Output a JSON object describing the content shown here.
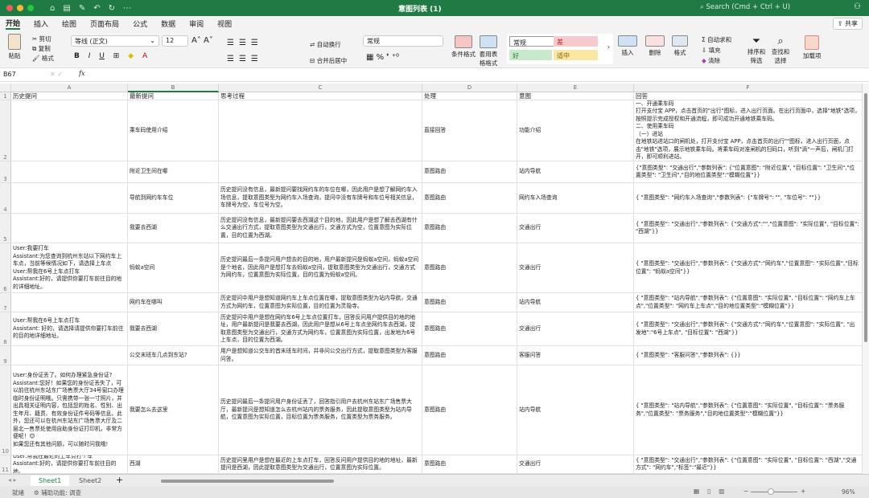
{
  "window": {
    "title": "意图列表 (1)",
    "search_placeholder": "Search (Cmd + Ctrl + U)"
  },
  "colors": {
    "titlebar": "#1f7a44",
    "bad": "#f7c9cc",
    "good": "#c9e9cc",
    "neutral": "#fbe7a4"
  },
  "menu": [
    "开始",
    "插入",
    "绘图",
    "页面布局",
    "公式",
    "数据",
    "审阅",
    "视图"
  ],
  "share_label": "共享",
  "ribbon": {
    "paste": "粘贴",
    "cut": "剪切",
    "copy": "复制",
    "format_painter": "格式",
    "font": "等线 (正文)",
    "size": "12",
    "wrap": "自动换行",
    "merge": "合并后居中",
    "number_format": "常规",
    "cond_format": "条件格式",
    "table_format": "套用表格格式",
    "styles": {
      "normal": "常规",
      "bad": "差",
      "good": "好",
      "neutral": "适中"
    },
    "insert": "插入",
    "delete": "删除",
    "format": "格式",
    "autosum": "自动求和",
    "fill": "填充",
    "clear": "清除",
    "sort": "排序和筛选",
    "find": "查找和选择",
    "addins": "加载项"
  },
  "formula": {
    "cell_ref": "B67",
    "fx": "fx"
  },
  "columns": [
    "A",
    "B",
    "C",
    "D",
    "E",
    "F"
  ],
  "rows": [
    {
      "n": "1",
      "cells": [
        "历史提问",
        "最新提问",
        "思考过程",
        "处理",
        "意图",
        "回答"
      ]
    },
    {
      "n": "2",
      "cells": [
        "",
        "乘车码使用介绍",
        "",
        "直接回答",
        "功能介绍",
        "一、开通乘车码\n打开支付宝 APP，点击首页的\"出行\"图标，进入出行页面。在出行页面中，选择\"地铁\"选项，按照提示完成授权和开通流程，即可成功开通地铁乘车码。\n二、使用乘车码\n（一）进站\n在地铁站进站口的闸机处，打开支付宝 APP，点击首页的出行\"\"图标，进入出行页面，点击\"地铁\"选项，展示地铁乘车码。将乘车码对准闸机的扫码口，听到\"滴\"一声后，闸机门打开，即可顺利进站。"
      ]
    },
    {
      "n": "3",
      "cells": [
        "",
        "附近卫生间在哪",
        "",
        "意图路由",
        "站内导航",
        "{\"意图类型\": \"交通出行\",\"参数列表\": {\"位置意图\": \"附近位置\", \"目标位置\": \"卫生间\",\"位置类型\": \"卫生间\",\"目的地位置类型\":\"模糊位置\"}}"
      ]
    },
    {
      "n": "4",
      "cells": [
        "",
        "导航到网约车车位",
        "历史提问没有信息，最新提问要找网约车的车位在哪，因此用户是想了解网约车入场信息，提取意图类型为网约车入场查询，提问中没有车牌号和车位号相关信息，车牌号为空，车位号为空。",
        "意图路由",
        "网约车入场查询",
        "{ \"意图类型\": \"网约车入场查询\",\"参数列表\": {\"车牌号\": \"\", \"车位号\": \"\"}}"
      ]
    },
    {
      "n": "5",
      "cells": [
        "",
        "我要去西湖",
        "历史提问没有信息，最新提问要去西湖这个目的地，因此用户是想了解去西湖有什么交通出行方式，提取意图类型为交通出行，交通方式为空，位置意图为实际位置，目的位置为西湖。",
        "意图路由",
        "交通出行",
        "{ \"意图类型\": \"交通出行\",\"参数列表\": {\"交通方式\":\"\",\"位置意图\": \"实际位置\", \"目标位置\": \"西湖\"}}"
      ]
    },
    {
      "n": "6",
      "cells": [
        "User:我要打车\nAssistant:为您查询到杭州东站以下网约车上车点，当前等候情况如下，请选择上车点\nUser:帮我在6号上车点打车\nAssistant:好的，请提供你要打车前往目的地的详细地址。",
        "蚂蚁a空间",
        "历史提问最后一条提问用户想去的目的地，用户最新提问是蚂蚁a空间，蚂蚁a空间是个地名，因此用户是想打车去蚂蚁a空间，提取意图类型为交通出行，交通方式为网约车，位置意图为实际位置，目的位置为蚂蚁a空间。",
        "意图路由",
        "交通出行",
        "{ \"意图类型\": \"交通出行\",\"参数列表\": {\"交通方式\":\"网约车\",\"位置意图\": \"实际位置\",\"目标位置\": \"蚂蚁a空间\"}}"
      ]
    },
    {
      "n": "7",
      "cells": [
        "",
        "网约车在哪叫",
        "历史提问中用户是想知道网约车上车点位置在哪，提取意图类型为站内导航，交通方式为网约车，位置意图为实际位置，目的位置为灵隐寺。",
        "意图路由",
        "站内导航",
        "{ \"意图类型\": \"站内导航\",\"参数列表\": {\"位置意图\": \"实际位置\", \"目标位置\": \"网约车上车点\",\"位置类型\": \"网约车上车点\",\"目的地位置类型\":\"模糊位置\"}}"
      ]
    },
    {
      "n": "8",
      "cells": [
        "User:帮我在6号上车点打车\nAssistant: 好的，请选择请提供你要打车前往的目的地详细地址。",
        "我要去西湖",
        "历史提问中用户是想在网约车6号上车点位置打车，回答反问用户提供目的地的地址，用户最新提问是我要去西湖，因此用户是想从6号上车点坐网约车去西湖，提取意图类型为交通出行，交通方式为网约车，位置意图为实际位置，出发地为6号上车点，目的位置为西湖。",
        "意图路由",
        "交通出行",
        "{ \"意图类型\": \"交通出行\",\"参数列表\": {\"交通方式\":\"网约车\",\"位置意图\": \"实际位置\", \"出发地\":\"6号上车点\", \"目标位置\": \"西湖\"}}"
      ]
    },
    {
      "n": "9",
      "cells": [
        "",
        "公交末班车几点到东站?",
        "用户是想知道公交车的首末班车时间，并非问公交出行方式，提取意图类型为客服问答。",
        "意图路由",
        "客服问答",
        "{ \"意图类型\": \"客服问答\",\"参数列表\": {}}"
      ]
    },
    {
      "n": "10",
      "cells": [
        "User:身份证丢了。如何办理紧急身份证?\nAssistant:您好！如果您的身份证丢失了，可以前往杭州东站东广场售票大厅34号窗口办理临时身份证明哦。只需携带一张一寸照片，并出具相关证明内容，包括您的姓名、性别、出生年月、籍贯、有效身份证件号码等信息。此外，您还可以在杭州东站东广场售票大厅及二层北一售票处使用自助身份证打印机，非常方便呢！😊\n如果您还有其他问题，可以随时问我哦!",
        "我要怎么去这里",
        "历史提问最后一条提问用户身份证丢了，回答指引用户去杭州东站东广场售票大厅，最新提问是想知道怎么去杭州站内的票务服务，因此提取意图类型为站内导航，位置意图为实际位置，目标位置为票务服务，位置类型为票务服务。",
        "意图路由",
        "站内导航",
        "{ \"意图类型\": \"站内导航\",\"参数列表\": {\"位置意图\": \"实际位置\", \"目标位置\": \"票务服务\",\"位置类型\": \"票务服务\",\"目的地位置类型\":\"模糊位置\"}}"
      ]
    },
    {
      "n": "11",
      "cells": [
        "User:帮我在最近的上车点打个车\nAssistant:好的，请提供你要打车前往目的地。",
        "西湖",
        "历史提问里用户是想在最近的上车点打车，回答反问用户提供目的地的地址，最新提问是西湖，因此提取意图类型为交通出行，位置意图为实际位置。",
        "意图路由",
        "交通出行",
        "{ \"意图类型\": \"交通出行\",\"参数列表\": {\"位置意图\": \"实际位置\", \"目标位置\": \"西湖\",\"交通方式\": \"网约车\",\"标签\":\"最近\"}}"
      ]
    }
  ],
  "sheets": [
    "Sheet1",
    "Sheet2"
  ],
  "status": {
    "ready": "就绪",
    "accessibility": "辅助功能: 调查",
    "zoom": "96%"
  }
}
